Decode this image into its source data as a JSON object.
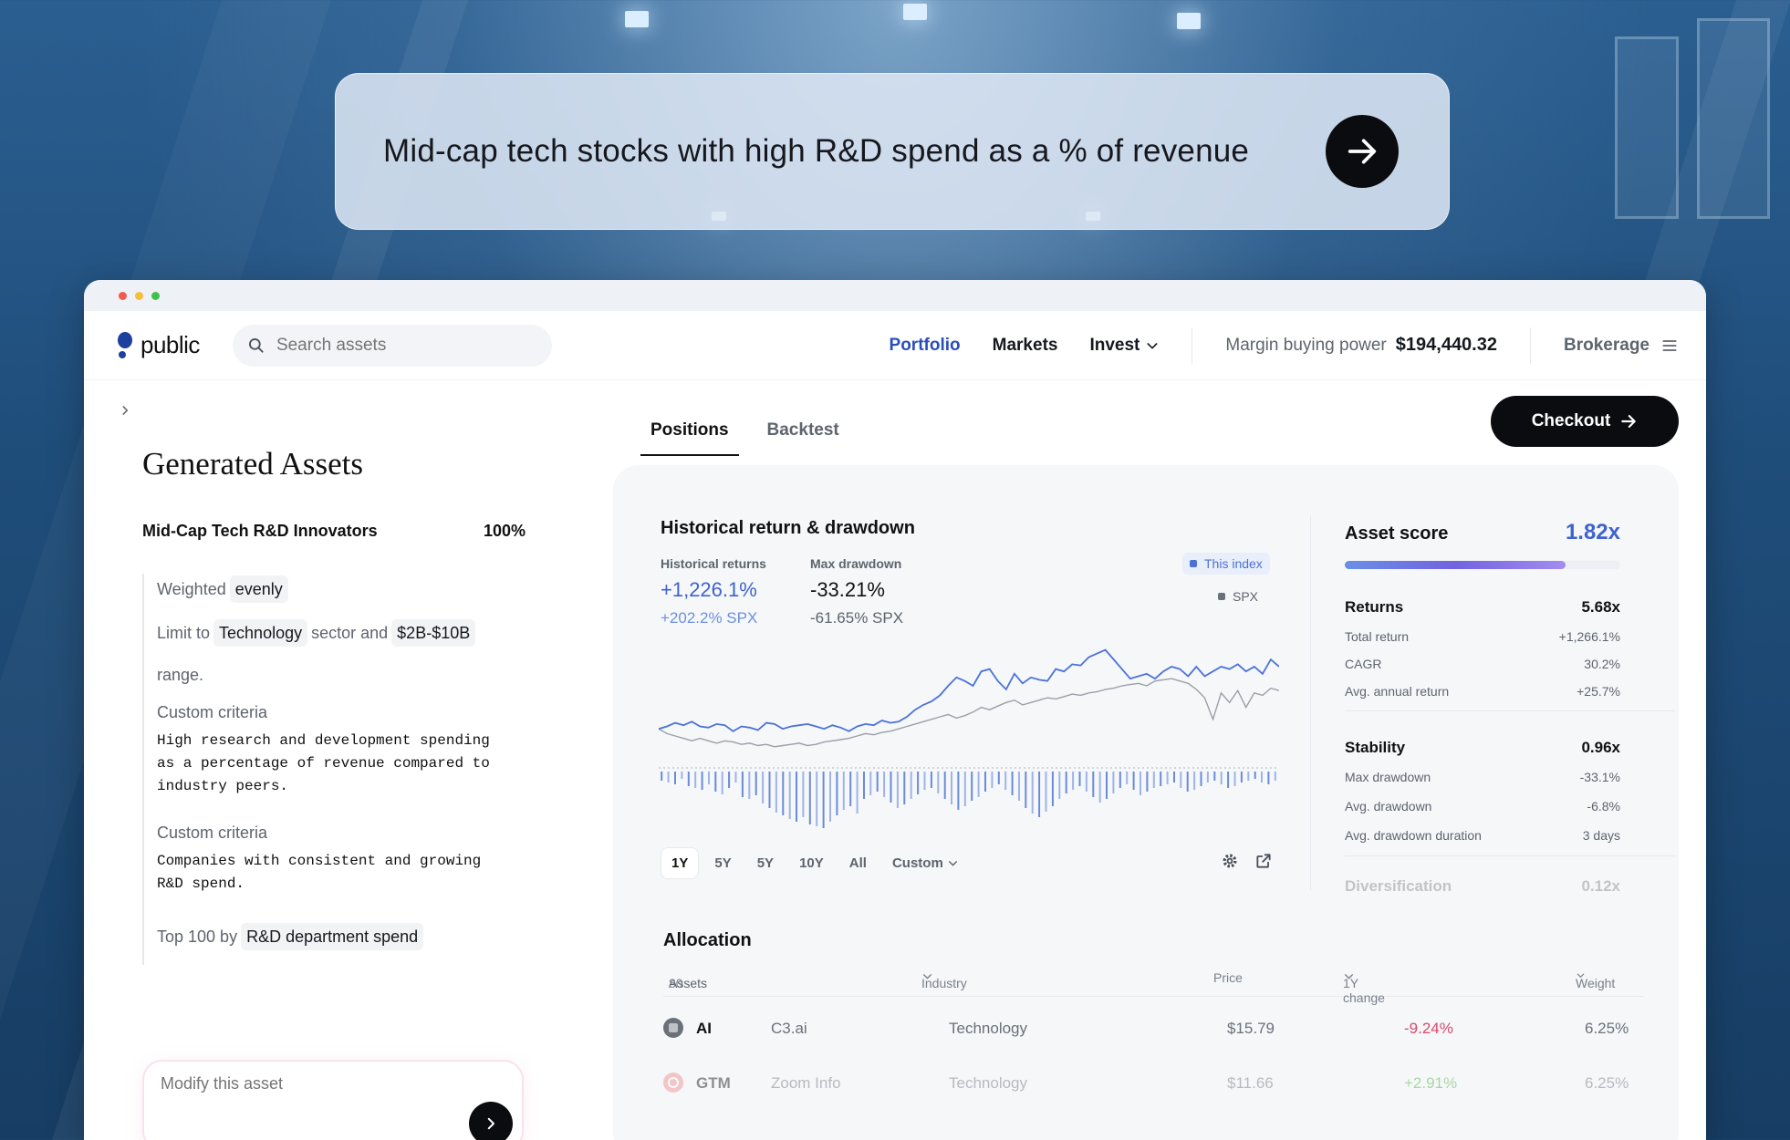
{
  "prompt": {
    "text": "Mid-cap tech stocks with high R&D spend as a % of revenue"
  },
  "nav": {
    "logo": "public",
    "search_placeholder": "Search assets",
    "links": [
      "Portfolio",
      "Markets",
      "Invest"
    ],
    "margin_label": "Margin buying power",
    "margin_value": "$194,440.32",
    "brokerage": "Brokerage"
  },
  "left": {
    "title": "Generated Assets",
    "index_name": "Mid-Cap Tech R&D Innovators",
    "index_pct": "100%",
    "weighted_prefix": "Weighted",
    "weighted_chip": "evenly",
    "limit_prefix": "Limit to",
    "limit_chip1": "Technology",
    "limit_mid": "sector and",
    "limit_chip2": "$2B-$10B",
    "limit_suffix": "range.",
    "custom1_label": "Custom criteria",
    "custom1_text": "High research and development spending as a percentage of revenue compared to industry peers.",
    "custom2_label": "Custom criteria",
    "custom2_text": "Companies with consistent and growing R&D spend.",
    "top_prefix": "Top 100 by",
    "top_chip": "R&D department spend",
    "modify_placeholder": "Modify this asset"
  },
  "tabs": [
    "Positions",
    "Backtest"
  ],
  "checkout_label": "Checkout",
  "chart_section": {
    "title": "Historical return & drawdown",
    "hist_label": "Historical returns",
    "hist_value": "+1,226.1%",
    "hist_spx": "+202.2% SPX",
    "dd_label": "Max drawdown",
    "dd_value": "-33.21%",
    "dd_spx": "-61.65% SPX",
    "legend_index": "This index",
    "legend_spx": "SPX",
    "ranges": [
      "1Y",
      "5Y",
      "5Y",
      "10Y",
      "All",
      "Custom"
    ]
  },
  "chart_data": {
    "type": "line",
    "title": "Historical return & drawdown",
    "series": [
      {
        "name": "This index",
        "values": [
          22,
          24,
          27,
          25,
          28,
          24,
          23,
          26,
          25,
          20,
          24,
          23,
          21,
          27,
          26,
          22,
          24,
          25,
          26,
          24,
          22,
          25,
          23,
          20,
          24,
          26,
          25,
          29,
          27,
          28,
          32,
          38,
          42,
          45,
          50,
          58,
          65,
          62,
          58,
          70,
          72,
          62,
          55,
          68,
          60,
          65,
          63,
          62,
          72,
          70,
          76,
          75,
          82,
          85,
          88,
          80,
          72,
          64,
          66,
          68,
          64,
          70,
          74,
          72,
          66,
          74,
          66,
          70,
          74,
          72,
          76,
          70,
          74,
          68,
          80,
          74
        ]
      },
      {
        "name": "SPX",
        "values": [
          22,
          18,
          16,
          14,
          12,
          14,
          12,
          10,
          12,
          11,
          9,
          10,
          8,
          9,
          7,
          8,
          9,
          10,
          8,
          9,
          11,
          12,
          13,
          14,
          16,
          18,
          17,
          19,
          20,
          22,
          24,
          26,
          28,
          30,
          32,
          34,
          31,
          33,
          36,
          40,
          38,
          41,
          44,
          46,
          42,
          44,
          46,
          48,
          47,
          49,
          51,
          50,
          52,
          53,
          55,
          56,
          58,
          59,
          60,
          58,
          62,
          63,
          64,
          62,
          60,
          55,
          48,
          30,
          52,
          44,
          54,
          40,
          52,
          50,
          56,
          54
        ]
      }
    ],
    "drawdown_bars": [
      10,
      12,
      14,
      8,
      16,
      18,
      20,
      14,
      22,
      25,
      18,
      12,
      28,
      30,
      26,
      35,
      40,
      45,
      48,
      52,
      55,
      50,
      58,
      60,
      62,
      55,
      48,
      42,
      38,
      46,
      30,
      26,
      22,
      28,
      34,
      40,
      36,
      30,
      25,
      20,
      18,
      24,
      30,
      36,
      42,
      38,
      32,
      28,
      22,
      18,
      14,
      20,
      26,
      32,
      40,
      46,
      50,
      44,
      38,
      30,
      24,
      20,
      16,
      22,
      28,
      34,
      30,
      24,
      18,
      14,
      20,
      26,
      22,
      18,
      16,
      14,
      12,
      18,
      22,
      20,
      16,
      12,
      10,
      14,
      18,
      16,
      12,
      10,
      8,
      12,
      14,
      10
    ]
  },
  "score": {
    "label": "Asset score",
    "value": "1.82x",
    "fill": 0.8,
    "returns": {
      "label": "Returns",
      "value": "5.68x",
      "rows": [
        [
          "Total return",
          "+1,266.1%"
        ],
        [
          "CAGR",
          "30.2%"
        ],
        [
          "Avg. annual return",
          "+25.7%"
        ]
      ]
    },
    "stability": {
      "label": "Stability",
      "value": "0.96x",
      "rows": [
        [
          "Max drawdown",
          "-33.1%"
        ],
        [
          "Avg. drawdown",
          "-6.8%"
        ],
        [
          "Avg. drawdown duration",
          "3 days"
        ]
      ]
    },
    "diversification": {
      "label": "Diversification",
      "value": "0.12x"
    }
  },
  "allocation": {
    "title": "Allocation",
    "headers": {
      "assets": "Assets",
      "assets_count": "80",
      "industry": "Industry",
      "price": "Price",
      "change": "1Y change",
      "weight": "Weight"
    },
    "rows": [
      {
        "ticker": "AI",
        "name": "C3.ai",
        "industry": "Technology",
        "price": "$15.79",
        "change": "-9.24%",
        "weight": "6.25%"
      },
      {
        "ticker": "GTM",
        "name": "Zoom Info",
        "industry": "Technology",
        "price": "$11.66",
        "change": "+2.91%",
        "weight": "6.25%"
      }
    ]
  },
  "colors": {
    "accent": "#2a4ebb",
    "index_line": "#4b72d8",
    "spx_line": "#9aa0a8",
    "negative": "#d84a6c",
    "positive": "#6bbf59"
  }
}
